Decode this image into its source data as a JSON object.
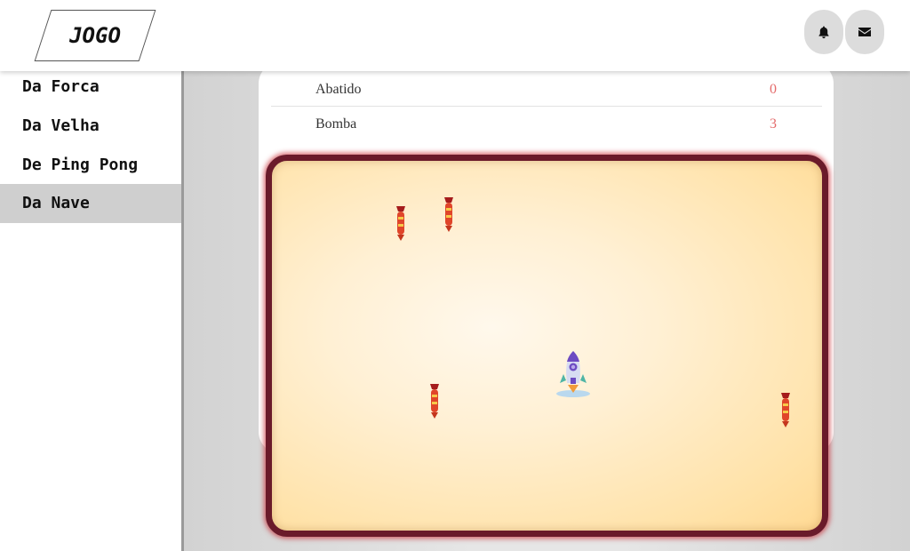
{
  "header": {
    "logo_text": "JOGO",
    "notifications_icon": "bell-icon",
    "messages_icon": "envelope-icon"
  },
  "sidebar": {
    "items": [
      {
        "label": "Da Forca",
        "active": false
      },
      {
        "label": "Da Velha",
        "active": false
      },
      {
        "label": "De Ping Pong",
        "active": false
      },
      {
        "label": "Da Nave",
        "active": true
      }
    ]
  },
  "scoreboard": {
    "rows": [
      {
        "label": "Abatido",
        "value": "0"
      },
      {
        "label": "Bomba",
        "value": "3"
      }
    ]
  },
  "game": {
    "player": "rocket-icon",
    "enemies": [
      "bomb-icon",
      "bomb-icon",
      "bomb-icon",
      "bomb-icon"
    ],
    "colors": {
      "border": "#6a1a2a",
      "background": "#ffe2a8",
      "score_value": "#e46a6a"
    }
  }
}
